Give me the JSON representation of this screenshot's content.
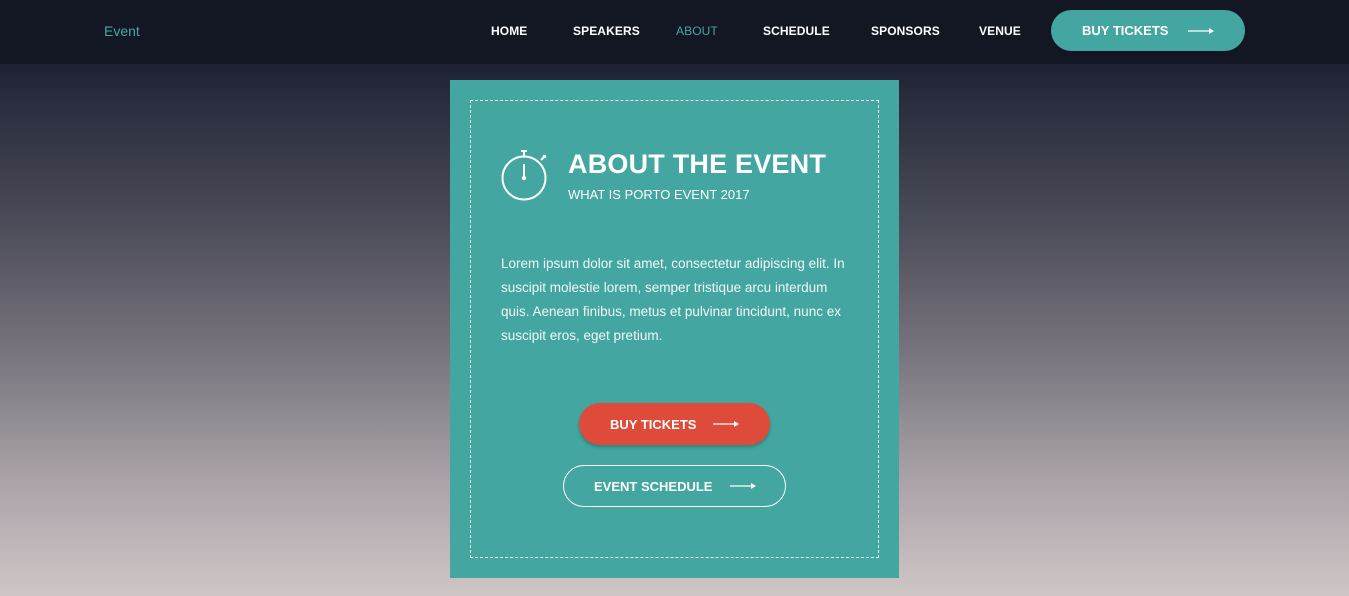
{
  "header": {
    "logo": "Event",
    "nav": [
      {
        "label": "HOME"
      },
      {
        "label": "SPEAKERS"
      },
      {
        "label": "ABOUT"
      },
      {
        "label": "SCHEDULE"
      },
      {
        "label": "SPONSORS"
      },
      {
        "label": "VENUE"
      }
    ],
    "active_nav": "ABOUT",
    "cta_label": "BUY TICKETS"
  },
  "about": {
    "title": "ABOUT THE EVENT",
    "subtitle": "WHAT IS PORTO EVENT 2017",
    "body": "Lorem ipsum dolor sit amet, consectetur adipiscing elit. In suscipit molestie lorem, semper tristique arcu interdum quis. Aenean finibus, metus et pulvinar tincidunt, nunc ex suscipit eros, eget pretium.",
    "buy_label": "BUY TICKETS",
    "schedule_label": "EVENT SCHEDULE",
    "icon": "stopwatch-icon"
  },
  "colors": {
    "accent": "#44a6a1",
    "topbar": "#131724",
    "cta_red": "#de4b3a"
  }
}
